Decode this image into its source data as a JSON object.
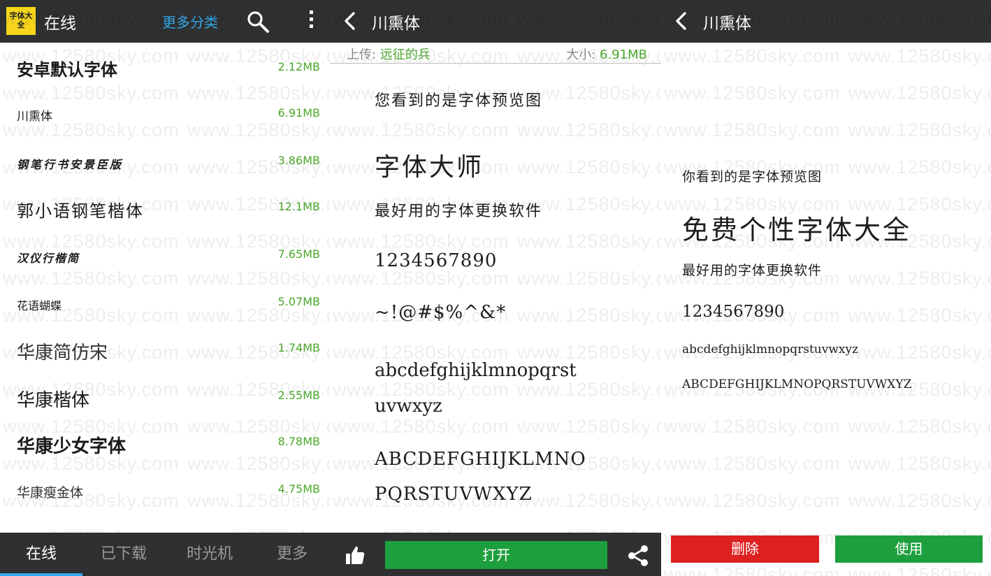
{
  "watermark": "www.12580sky.com",
  "list_panel": {
    "logo_text": "字体大全",
    "title": "在线",
    "more_categories": "更多分类",
    "fonts": [
      {
        "name": "安卓默认字体",
        "size": "2.12MB"
      },
      {
        "name": "川熏体",
        "size": "6.91MB"
      },
      {
        "name": "钢笔行书安景臣版",
        "size": "3.86MB"
      },
      {
        "name": "郭小语钢笔楷体",
        "size": "12.1MB"
      },
      {
        "name": "汉仪行楷简",
        "size": "7.65MB"
      },
      {
        "name": "花语蝴蝶",
        "size": "5.07MB"
      },
      {
        "name": "华康简仿宋",
        "size": "1.74MB"
      },
      {
        "name": "华康楷体",
        "size": "2.55MB"
      },
      {
        "name": "华康少女字体",
        "size": "8.78MB"
      },
      {
        "name": "华康瘦金体",
        "size": "4.75MB"
      }
    ],
    "tabs": [
      "在线",
      "已下载",
      "时光机",
      "更多"
    ]
  },
  "detail_panel": {
    "title": "川熏体",
    "upload_label": "上传: ",
    "uploader": "远征的兵",
    "size_label": "大小: ",
    "size": "6.91MB",
    "preview": {
      "line1": "您看到的是字体预览图",
      "line2": "字体大师",
      "line3": "最好用的字体更换软件",
      "line4": "1234567890",
      "line5": "~!@#$%^&*",
      "line6": "abcdefghijklmnopqrst",
      "line7": "uvwxyz",
      "line8": "ABCDEFGHIJKLMNO",
      "line9": "PQRSTUVWXYZ"
    },
    "open_label": "打开"
  },
  "installed_panel": {
    "title": "川熏体",
    "preview": {
      "line1": "你看到的是字体预览图",
      "line2": "免费个性字体大全",
      "line3": "最好用的字体更换软件",
      "line4": "1234567890",
      "line5": "abcdefghijklmnopqrstuvwxyz",
      "line6": "ABCDEFGHIJKLMNOPQRSTUVWXYZ"
    },
    "delete_label": "删除",
    "use_label": "使用"
  },
  "colors": {
    "bar": "#2e3031",
    "accent_blue": "#33a7e8",
    "size_green": "#4ca82c",
    "button_green": "#1e9f3e",
    "button_red": "#dd2020",
    "logo_yellow": "#f6d51c"
  }
}
